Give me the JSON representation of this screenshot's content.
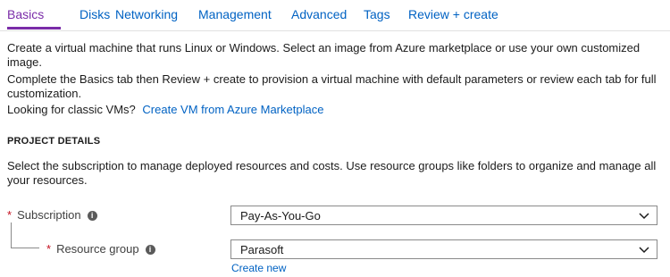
{
  "tabs": [
    {
      "label": "Basics"
    },
    {
      "label": "Disks"
    },
    {
      "label": "Networking"
    },
    {
      "label": "Management"
    },
    {
      "label": "Advanced"
    },
    {
      "label": "Tags"
    },
    {
      "label": "Review + create"
    }
  ],
  "intro": {
    "line1": "Create a virtual machine that runs Linux or Windows. Select an image from Azure marketplace or use your own customized",
    "line2": "image.",
    "line3": "Complete the Basics tab then Review + create to provision a virtual machine with default parameters or review each tab for full",
    "line4": "customization.",
    "classic_text": "Looking for classic VMs?",
    "classic_link": "Create VM from Azure Marketplace"
  },
  "project_details": {
    "heading": "PROJECT DETAILS",
    "desc_line1": "Select the subscription to manage deployed resources and costs. Use resource groups like folders to organize and manage all",
    "desc_line2": "your resources."
  },
  "fields": {
    "required_mark": "*",
    "info_glyph": "i",
    "subscription": {
      "label": "Subscription",
      "value": "Pay-As-You-Go"
    },
    "resource_group": {
      "label": "Resource group",
      "value": "Parasoft",
      "create_new": "Create new"
    }
  },
  "colors": {
    "accent": "#7a2ca8",
    "link": "#0062c3",
    "required": "#c50f1f"
  }
}
